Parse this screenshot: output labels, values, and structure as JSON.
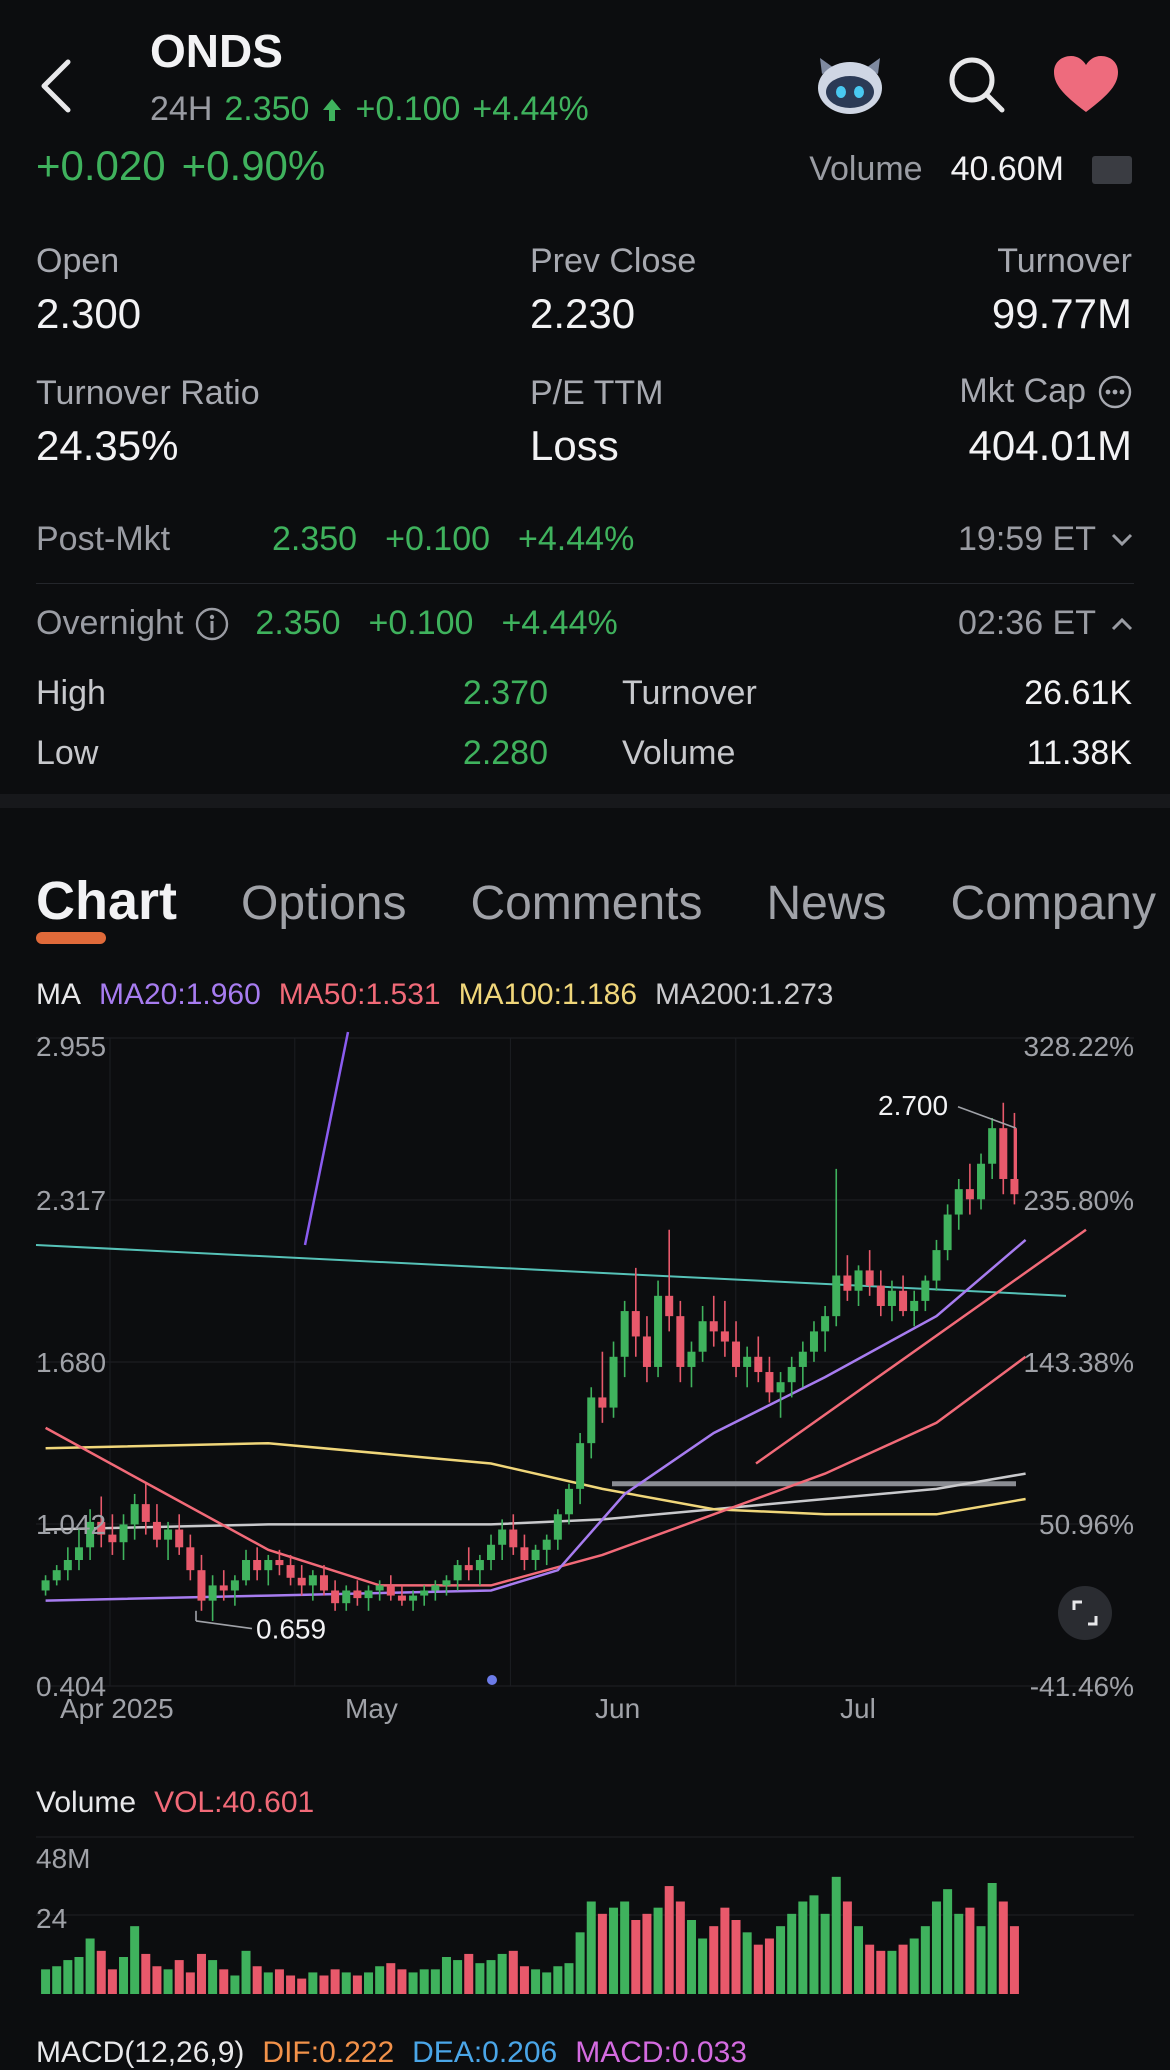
{
  "header": {
    "ticker": "ONDS",
    "session_label": "24H",
    "price": "2.350",
    "change": "+0.100",
    "change_pct": "+4.44%",
    "icons": [
      "back-arrow-icon",
      "robot-assistant-icon",
      "search-icon",
      "heart-icon"
    ]
  },
  "summary": {
    "day_change": "+0.020",
    "day_change_pct": "+0.90%",
    "volume_label": "Volume",
    "volume_value": "40.60M"
  },
  "stats": [
    {
      "label": "Open",
      "value": "2.300"
    },
    {
      "label": "Prev Close",
      "value": "2.230"
    },
    {
      "label": "Turnover",
      "value": "99.77M"
    },
    {
      "label": "Turnover Ratio",
      "value": "24.35%"
    },
    {
      "label": "P/E TTM",
      "value": "Loss"
    },
    {
      "label": "Mkt Cap",
      "value": "404.01M"
    }
  ],
  "post_market": {
    "label": "Post-Mkt",
    "price": "2.350",
    "change": "+0.100",
    "change_pct": "+4.44%",
    "time": "19:59 ET"
  },
  "overnight": {
    "label": "Overnight",
    "price": "2.350",
    "change": "+0.100",
    "change_pct": "+4.44%",
    "time": "02:36 ET",
    "high_label": "High",
    "high": "2.370",
    "low_label": "Low",
    "low": "2.280",
    "turnover_label": "Turnover",
    "turnover": "26.61K",
    "volume_label": "Volume",
    "volume": "11.38K"
  },
  "tabs": [
    "Chart",
    "Options",
    "Comments",
    "News",
    "Company"
  ],
  "ma_legend": {
    "prefix": "MA",
    "ma20": "MA20:1.960",
    "ma50": "MA50:1.531",
    "ma100": "MA100:1.186",
    "ma200": "MA200:1.273"
  },
  "colors": {
    "up": "#3fb25d",
    "down": "#e8596b",
    "ma20": "#a77cf0",
    "ma50": "#f26a78",
    "ma100": "#f0d67a",
    "ma200": "#c9c9cc",
    "trendline": "#56c2b8",
    "accent": "#e06a3a"
  },
  "chart_data": {
    "type": "candlestick",
    "y_ticks": [
      "2.955",
      "2.317",
      "1.680",
      "1.042",
      "0.404"
    ],
    "y_pct_ticks": [
      "328.22%",
      "235.80%",
      "143.38%",
      "50.96%",
      "-41.46%"
    ],
    "x_ticks": [
      "Apr 2025",
      "May",
      "Jun",
      "Jul"
    ],
    "ylim": [
      0.404,
      2.955
    ],
    "annotations": {
      "max": "2.700",
      "min": "0.659"
    },
    "ohlc": [
      [
        0.78,
        0.84,
        0.76,
        0.82
      ],
      [
        0.82,
        0.88,
        0.8,
        0.86
      ],
      [
        0.86,
        0.95,
        0.82,
        0.9
      ],
      [
        0.9,
        1.02,
        0.86,
        0.95
      ],
      [
        0.95,
        1.1,
        0.9,
        1.05
      ],
      [
        1.05,
        1.15,
        0.95,
        1.0
      ],
      [
        1.0,
        1.08,
        0.92,
        0.97
      ],
      [
        0.97,
        1.08,
        0.9,
        1.04
      ],
      [
        1.04,
        1.16,
        0.98,
        1.12
      ],
      [
        1.12,
        1.2,
        1.0,
        1.05
      ],
      [
        1.05,
        1.12,
        0.95,
        0.98
      ],
      [
        0.98,
        1.05,
        0.9,
        1.02
      ],
      [
        1.02,
        1.08,
        0.92,
        0.95
      ],
      [
        0.95,
        1.0,
        0.82,
        0.86
      ],
      [
        0.86,
        0.92,
        0.7,
        0.74
      ],
      [
        0.74,
        0.84,
        0.66,
        0.8
      ],
      [
        0.8,
        0.86,
        0.74,
        0.78
      ],
      [
        0.78,
        0.84,
        0.72,
        0.82
      ],
      [
        0.82,
        0.94,
        0.8,
        0.9
      ],
      [
        0.9,
        0.95,
        0.82,
        0.86
      ],
      [
        0.86,
        0.92,
        0.8,
        0.9
      ],
      [
        0.9,
        0.94,
        0.84,
        0.88
      ],
      [
        0.88,
        0.92,
        0.8,
        0.83
      ],
      [
        0.83,
        0.88,
        0.76,
        0.8
      ],
      [
        0.8,
        0.86,
        0.74,
        0.84
      ],
      [
        0.84,
        0.88,
        0.76,
        0.78
      ],
      [
        0.78,
        0.82,
        0.7,
        0.73
      ],
      [
        0.73,
        0.8,
        0.7,
        0.78
      ],
      [
        0.78,
        0.82,
        0.72,
        0.75
      ],
      [
        0.75,
        0.8,
        0.7,
        0.78
      ],
      [
        0.78,
        0.82,
        0.74,
        0.8
      ],
      [
        0.8,
        0.84,
        0.74,
        0.76
      ],
      [
        0.76,
        0.8,
        0.72,
        0.74
      ],
      [
        0.74,
        0.78,
        0.7,
        0.76
      ],
      [
        0.76,
        0.8,
        0.72,
        0.78
      ],
      [
        0.78,
        0.82,
        0.74,
        0.8
      ],
      [
        0.8,
        0.84,
        0.76,
        0.82
      ],
      [
        0.82,
        0.9,
        0.78,
        0.88
      ],
      [
        0.88,
        0.95,
        0.82,
        0.86
      ],
      [
        0.86,
        0.92,
        0.8,
        0.9
      ],
      [
        0.9,
        1.0,
        0.86,
        0.96
      ],
      [
        0.96,
        1.06,
        0.9,
        1.02
      ],
      [
        1.02,
        1.08,
        0.92,
        0.95
      ],
      [
        0.95,
        1.0,
        0.86,
        0.9
      ],
      [
        0.9,
        0.96,
        0.86,
        0.94
      ],
      [
        0.94,
        1.0,
        0.88,
        0.98
      ],
      [
        0.98,
        1.1,
        0.94,
        1.08
      ],
      [
        1.08,
        1.2,
        1.04,
        1.18
      ],
      [
        1.18,
        1.4,
        1.12,
        1.36
      ],
      [
        1.36,
        1.58,
        1.3,
        1.54
      ],
      [
        1.54,
        1.72,
        1.44,
        1.5
      ],
      [
        1.5,
        1.76,
        1.46,
        1.7
      ],
      [
        1.7,
        1.92,
        1.62,
        1.88
      ],
      [
        1.88,
        2.05,
        1.7,
        1.78
      ],
      [
        1.78,
        1.86,
        1.6,
        1.66
      ],
      [
        1.66,
        2.0,
        1.62,
        1.94
      ],
      [
        1.94,
        2.2,
        1.8,
        1.86
      ],
      [
        1.86,
        1.92,
        1.6,
        1.66
      ],
      [
        1.66,
        1.76,
        1.58,
        1.72
      ],
      [
        1.72,
        1.9,
        1.68,
        1.84
      ],
      [
        1.84,
        1.94,
        1.74,
        1.8
      ],
      [
        1.8,
        1.92,
        1.7,
        1.76
      ],
      [
        1.76,
        1.84,
        1.62,
        1.66
      ],
      [
        1.66,
        1.74,
        1.58,
        1.7
      ],
      [
        1.7,
        1.78,
        1.6,
        1.64
      ],
      [
        1.64,
        1.7,
        1.52,
        1.56
      ],
      [
        1.56,
        1.64,
        1.46,
        1.6
      ],
      [
        1.6,
        1.7,
        1.54,
        1.66
      ],
      [
        1.66,
        1.76,
        1.58,
        1.72
      ],
      [
        1.72,
        1.84,
        1.68,
        1.8
      ],
      [
        1.8,
        1.9,
        1.72,
        1.86
      ],
      [
        1.86,
        2.44,
        1.82,
        2.02
      ],
      [
        2.02,
        2.1,
        1.92,
        1.96
      ],
      [
        1.96,
        2.06,
        1.9,
        2.04
      ],
      [
        2.04,
        2.12,
        1.94,
        1.98
      ],
      [
        1.98,
        2.04,
        1.86,
        1.9
      ],
      [
        1.9,
        2.0,
        1.84,
        1.96
      ],
      [
        1.96,
        2.02,
        1.86,
        1.88
      ],
      [
        1.88,
        1.96,
        1.82,
        1.92
      ],
      [
        1.92,
        2.02,
        1.88,
        2.0
      ],
      [
        2.0,
        2.16,
        1.96,
        2.12
      ],
      [
        2.12,
        2.3,
        2.08,
        2.26
      ],
      [
        2.26,
        2.4,
        2.2,
        2.36
      ],
      [
        2.36,
        2.46,
        2.26,
        2.32
      ],
      [
        2.32,
        2.5,
        2.28,
        2.46
      ],
      [
        2.46,
        2.64,
        2.4,
        2.6
      ],
      [
        2.6,
        2.7,
        2.34,
        2.4
      ],
      [
        2.4,
        2.66,
        2.3,
        2.34
      ]
    ],
    "ma20_line": [
      [
        0,
        0.74
      ],
      [
        20,
        0.76
      ],
      [
        40,
        0.78
      ],
      [
        46,
        0.86
      ],
      [
        52,
        1.16
      ],
      [
        60,
        1.4
      ],
      [
        70,
        1.62
      ],
      [
        80,
        1.86
      ],
      [
        88,
        2.16
      ]
    ],
    "ma50_line": [
      [
        0,
        1.42
      ],
      [
        10,
        1.18
      ],
      [
        20,
        0.94
      ],
      [
        30,
        0.8
      ],
      [
        40,
        0.8
      ],
      [
        50,
        0.92
      ],
      [
        60,
        1.08
      ],
      [
        70,
        1.24
      ],
      [
        80,
        1.44
      ],
      [
        88,
        1.7
      ]
    ],
    "ma100_line": [
      [
        0,
        1.34
      ],
      [
        20,
        1.36
      ],
      [
        40,
        1.28
      ],
      [
        50,
        1.18
      ],
      [
        60,
        1.1
      ],
      [
        70,
        1.08
      ],
      [
        80,
        1.08
      ],
      [
        88,
        1.14
      ]
    ],
    "ma200_line": [
      [
        0,
        1.02
      ],
      [
        20,
        1.04
      ],
      [
        40,
        1.04
      ],
      [
        50,
        1.06
      ],
      [
        60,
        1.1
      ],
      [
        70,
        1.14
      ],
      [
        80,
        1.18
      ],
      [
        88,
        1.24
      ]
    ],
    "trendline_top": [
      [
        0,
        2.14
      ],
      [
        88,
        1.94
      ]
    ],
    "volume": {
      "label": "Volume",
      "vol_label": "VOL:40.601",
      "y_ticks": [
        "48M",
        "24"
      ],
      "ylim": [
        0,
        48
      ],
      "values": [
        8,
        9,
        11,
        12,
        18,
        14,
        8,
        12,
        22,
        13,
        9,
        8,
        11,
        7,
        13,
        11,
        8,
        6,
        14,
        9,
        7,
        8,
        6,
        5,
        7,
        6,
        8,
        7,
        6,
        7,
        9,
        10,
        8,
        7,
        8,
        8,
        12,
        11,
        13,
        10,
        11,
        13,
        14,
        9,
        8,
        7,
        9,
        10,
        20,
        30,
        26,
        28,
        30,
        24,
        26,
        28,
        35,
        30,
        24,
        18,
        22,
        28,
        24,
        20,
        16,
        18,
        22,
        26,
        30,
        32,
        26,
        38,
        30,
        22,
        16,
        14,
        14,
        16,
        18,
        22,
        30,
        34,
        26,
        28,
        22,
        36,
        30,
        22,
        34
      ]
    },
    "macd_label": {
      "name": "MACD(12,26,9)",
      "dif": "DIF:0.222",
      "dea": "DEA:0.206",
      "macd": "MACD:0.033"
    }
  }
}
